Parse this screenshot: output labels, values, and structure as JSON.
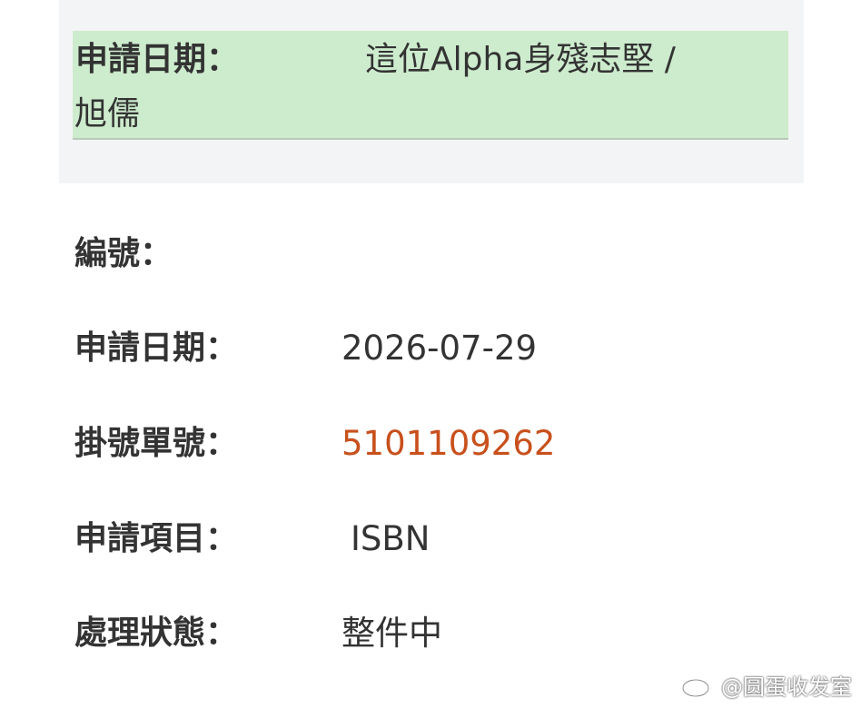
{
  "top_record": {
    "label": "申請日期：",
    "value_line1": "這位Alpha身殘志堅 /",
    "value_line2": "旭儒"
  },
  "fields": [
    {
      "label": "編號：",
      "value": ""
    },
    {
      "label": "申請日期：",
      "value": "2026-07-29"
    },
    {
      "label": "掛號單號：",
      "value": "5101109262",
      "value_color": "#c8501c"
    },
    {
      "label": "申請項目：",
      "value": "ISBN"
    },
    {
      "label": "處理狀態：",
      "value": "整件中"
    }
  ],
  "watermark": {
    "icon": "weibo-icon",
    "text": "@圆蛋收发室"
  },
  "colors": {
    "highlight_bg": "#cdebcd",
    "panel_bg": "#f3f4f6",
    "accent": "#c8501c",
    "text": "#333333"
  }
}
